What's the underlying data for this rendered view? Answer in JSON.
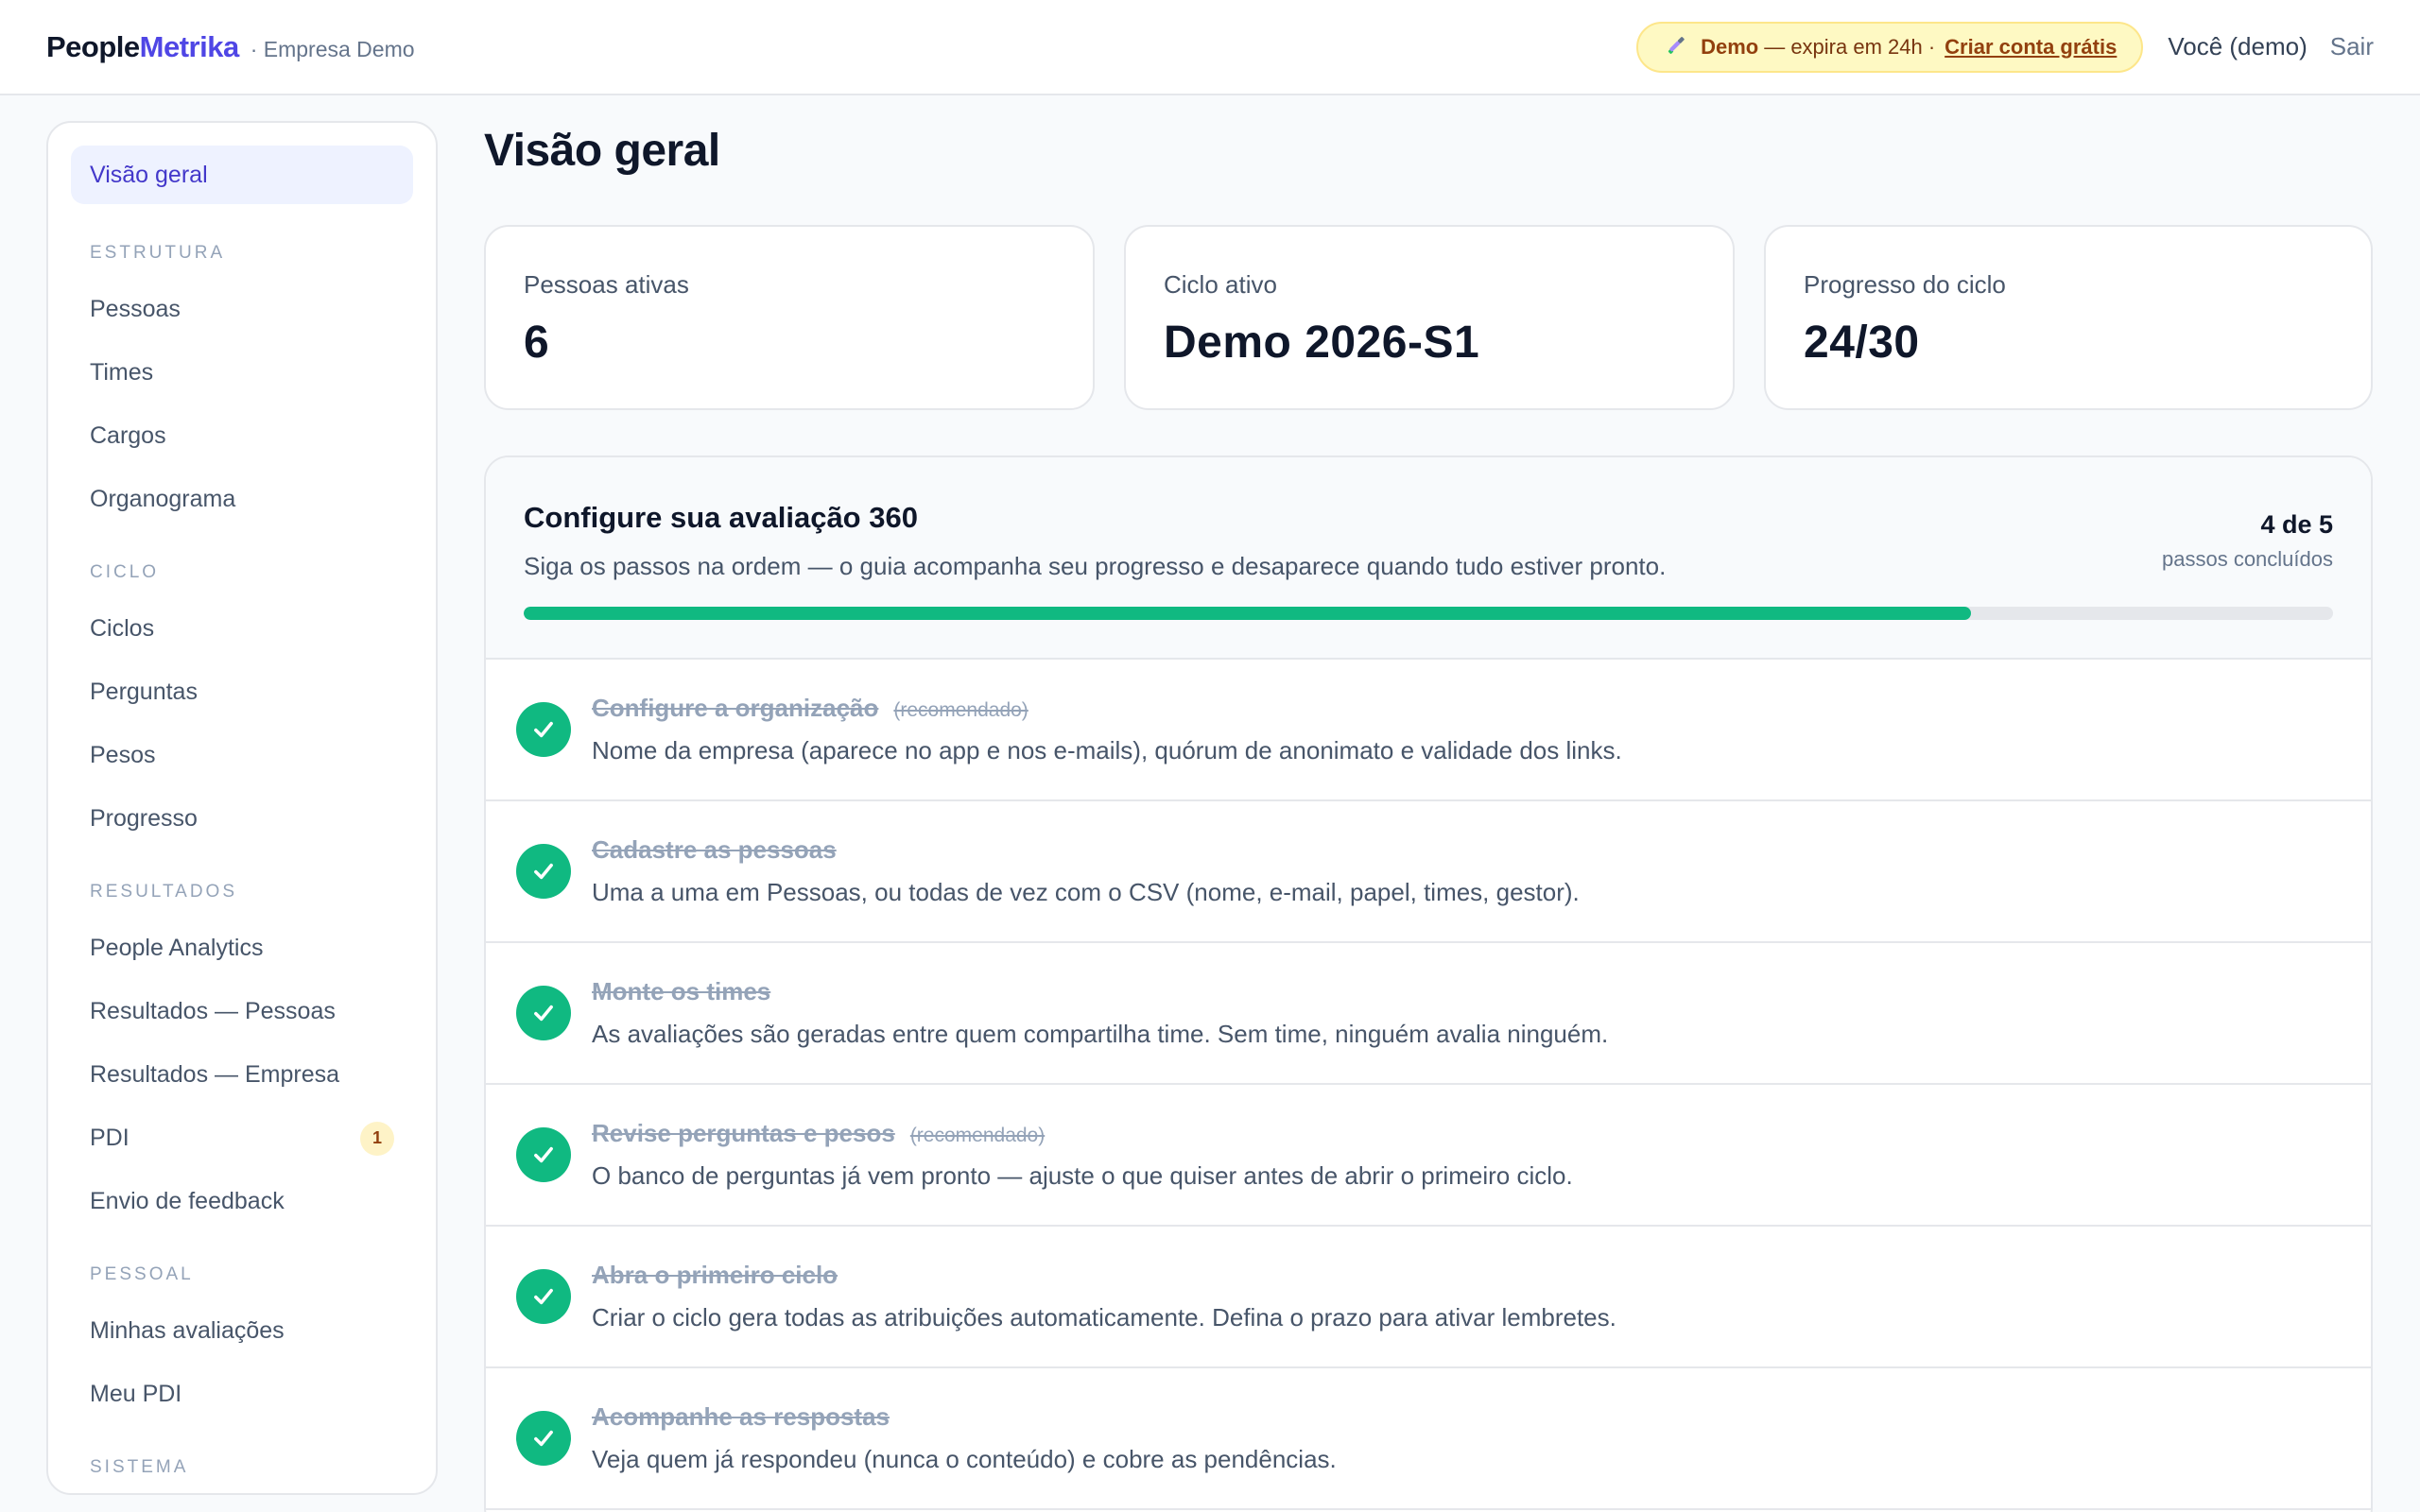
{
  "header": {
    "brand_part1": "People",
    "brand_part2": "Metrika",
    "company": "· Empresa Demo",
    "demo_label": "Demo",
    "demo_text": "— expira em 24h ·",
    "demo_link": "Criar conta grátis",
    "user": "Você (demo)",
    "logout": "Sair"
  },
  "sidebar": {
    "active": "Visão geral",
    "sections": [
      {
        "title": "Estrutura",
        "items": [
          {
            "label": "Pessoas"
          },
          {
            "label": "Times"
          },
          {
            "label": "Cargos"
          },
          {
            "label": "Organograma"
          }
        ]
      },
      {
        "title": "Ciclo",
        "items": [
          {
            "label": "Ciclos"
          },
          {
            "label": "Perguntas"
          },
          {
            "label": "Pesos"
          },
          {
            "label": "Progresso"
          }
        ]
      },
      {
        "title": "Resultados",
        "items": [
          {
            "label": "People Analytics"
          },
          {
            "label": "Resultados — Pessoas"
          },
          {
            "label": "Resultados — Empresa"
          },
          {
            "label": "PDI",
            "badge": "1"
          },
          {
            "label": "Envio de feedback"
          }
        ]
      },
      {
        "title": "Pessoal",
        "items": [
          {
            "label": "Minhas avaliações"
          },
          {
            "label": "Meu PDI"
          }
        ]
      },
      {
        "title": "Sistema",
        "items": []
      }
    ]
  },
  "main": {
    "title": "Visão geral",
    "stats": [
      {
        "label": "Pessoas ativas",
        "value": "6"
      },
      {
        "label": "Ciclo ativo",
        "value": "Demo 2026-S1"
      },
      {
        "label": "Progresso do ciclo",
        "value": "24/30"
      }
    ],
    "guide": {
      "title": "Configure sua avaliação 360",
      "subtitle": "Siga os passos na ordem — o guia acompanha seu progresso e desaparece quando tudo estiver pronto.",
      "count": "4 de 5",
      "count_label": "passos concluídos",
      "progress_fraction": 0.8,
      "progress_color": "#10b981",
      "steps": [
        {
          "title": "Configure a organização",
          "tag": "(recomendado)",
          "desc": "Nome da empresa (aparece no app e nos e-mails), quórum de anonimato e validade dos links."
        },
        {
          "title": "Cadastre as pessoas",
          "tag": "",
          "desc": "Uma a uma em Pessoas, ou todas de vez com o CSV (nome, e-mail, papel, times, gestor)."
        },
        {
          "title": "Monte os times",
          "tag": "",
          "desc": "As avaliações são geradas entre quem compartilha time. Sem time, ninguém avalia ninguém."
        },
        {
          "title": "Revise perguntas e pesos",
          "tag": "(recomendado)",
          "desc": "O banco de perguntas já vem pronto — ajuste o que quiser antes de abrir o primeiro ciclo."
        },
        {
          "title": "Abra o primeiro ciclo",
          "tag": "",
          "desc": "Criar o ciclo gera todas as atribuições automaticamente. Defina o prazo para ativar lembretes."
        },
        {
          "title": "Acompanhe as respostas",
          "tag": "",
          "desc": "Veja quem já respondeu (nunca o conteúdo) e cobre as pendências."
        }
      ]
    }
  }
}
